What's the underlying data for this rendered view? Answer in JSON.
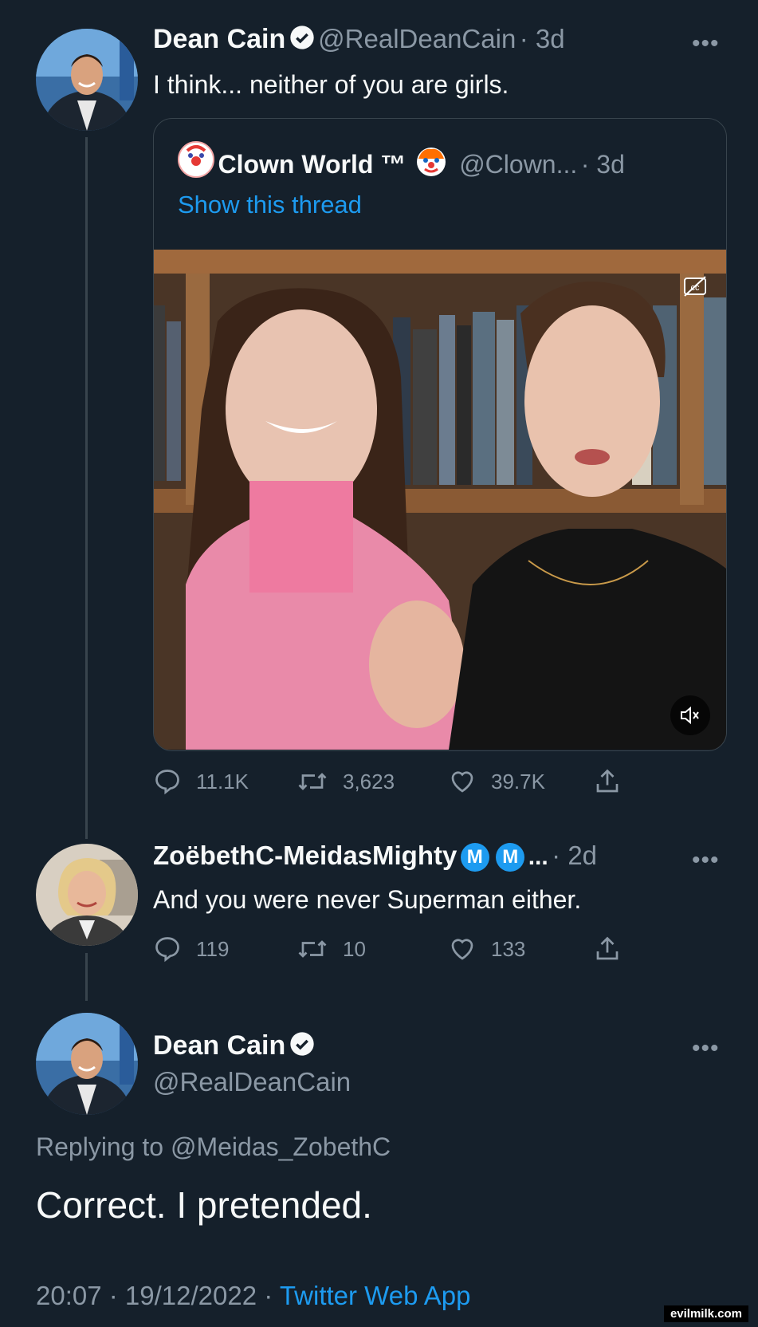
{
  "tweet1": {
    "name": "Dean Cain",
    "handle": "@RealDeanCain",
    "time": "· 3d",
    "text": "I think... neither of you are girls.",
    "quote": {
      "name": "Clown World ™",
      "handle": "@Clown...",
      "time": "· 3d",
      "show_thread": "Show this thread"
    },
    "stats": {
      "replies": "11.1K",
      "retweets": "3,623",
      "likes": "39.7K"
    }
  },
  "tweet2": {
    "name": "ZoëbethC-MeidasMighty",
    "badges": [
      "M",
      "M"
    ],
    "ellipsis": "...",
    "time": "· 2d",
    "text": "And you were never Superman either.",
    "stats": {
      "replies": "119",
      "retweets": "10",
      "likes": "133"
    }
  },
  "tweet3": {
    "name": "Dean Cain",
    "handle": "@RealDeanCain",
    "replying_prefix": "Replying to ",
    "replying_to": "@Meidas_ZobethC",
    "text": "Correct. I pretended.",
    "timestamp": "20:07 · 19/12/2022 · ",
    "source": "Twitter Web App"
  },
  "more_label": "•••",
  "watermark": "evilmilk.com",
  "colors": {
    "background": "#15202b",
    "accent": "#1d9bf0",
    "muted": "#8b98a5",
    "border": "#38444d"
  }
}
